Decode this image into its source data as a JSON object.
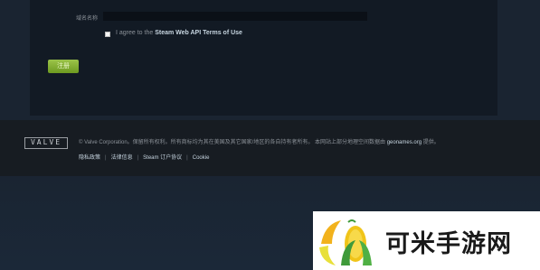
{
  "form": {
    "field_label": "域名名称",
    "field_value": "",
    "terms_prefix": "I agree to the ",
    "terms_link": "Steam Web API Terms of Use",
    "register_label": "注册"
  },
  "footer": {
    "logo_text": "VALVE",
    "copyright_prefix": "© Valve Corporation。保留所有权利。所有商标均为其在美国及其它国家/地区的各自持有者所有。 本网站上部分地理空间数据由 ",
    "copyright_link": "geonames.org",
    "copyright_suffix": " 提供。",
    "links": [
      "隐私政策",
      "法律信息",
      "Steam 订户协议",
      "Cookie"
    ]
  },
  "watermark": {
    "text": "可米手游网"
  },
  "colors": {
    "accent_green": "#7aa82a",
    "footer_bg": "#171c22",
    "panel_bg": "#121a24"
  }
}
